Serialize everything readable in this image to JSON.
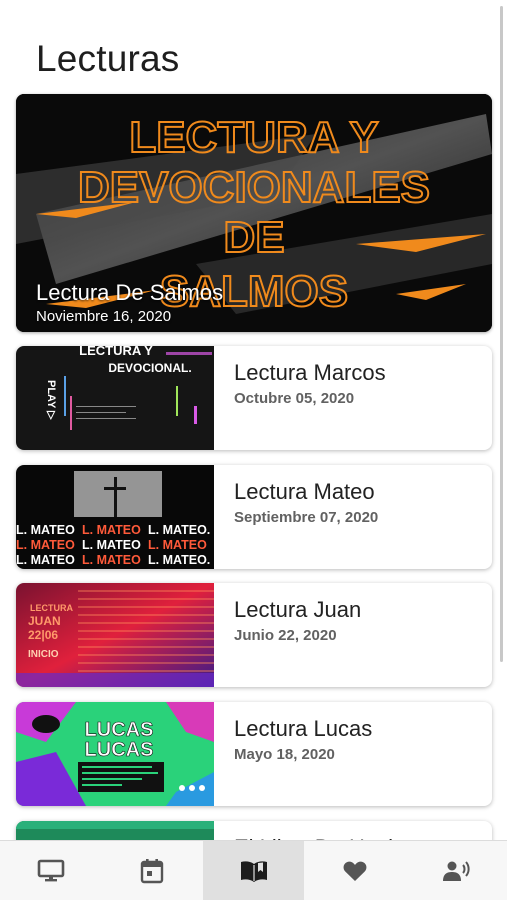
{
  "header": {
    "title": "Lecturas"
  },
  "featured": {
    "title": "Lectura De Salmos",
    "date": "Noviembre 16, 2020",
    "image_text": [
      "LECTURA Y",
      "DEVOCIONALES",
      "DE",
      "SALMOS"
    ]
  },
  "items": [
    {
      "title": "Lectura Marcos",
      "date": "Octubre 05, 2020",
      "image_text": [
        "LECTURA Y",
        "DEVOCIONAL.",
        "PLAY ▷"
      ]
    },
    {
      "title": "Lectura Mateo",
      "date": "Septiembre 07, 2020",
      "image_text": [
        "L. MATEO",
        "L. MATEO",
        "L. MATEO."
      ]
    },
    {
      "title": "Lectura Juan",
      "date": "Junio 22, 2020",
      "image_text": [
        "LECTURA",
        "JUAN",
        "22|06",
        "INICIO"
      ]
    },
    {
      "title": "Lectura Lucas",
      "date": "Mayo 18, 2020",
      "image_text": [
        "LUCAS",
        "LUCAS"
      ]
    },
    {
      "title": "El Libro De Hech"
    }
  ],
  "nav": [
    {
      "icon": "desktop-icon"
    },
    {
      "icon": "calendar-icon"
    },
    {
      "icon": "book-icon",
      "active": true
    },
    {
      "icon": "heart-icon"
    },
    {
      "icon": "contact-phone-icon"
    }
  ],
  "colors": {
    "accent_orange": "#f08a1c",
    "text_dark": "#212121",
    "date_gray": "#616161"
  }
}
